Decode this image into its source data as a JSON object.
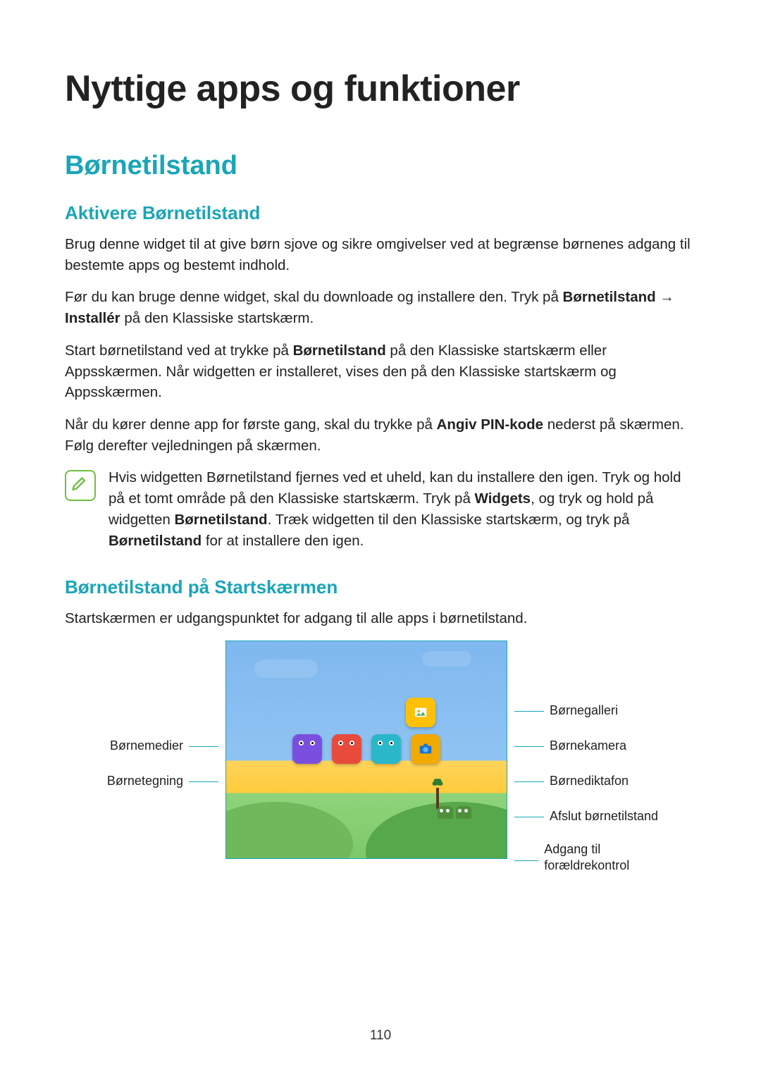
{
  "title": "Nyttige apps og funktioner",
  "section_h2": "Børnetilstand",
  "section_h3a": "Aktivere Børnetilstand",
  "p1": "Brug denne widget til at give børn sjove og sikre omgivelser ved at begrænse børnenes adgang til bestemte apps og bestemt indhold.",
  "p2a": "Før du kan bruge denne widget, skal du downloade og installere den. Tryk på ",
  "p2b_bold": "Børnetilstand",
  "p2c": " → ",
  "p2d_bold": "Installér",
  "p2e": " på den Klassiske startskærm.",
  "p3a": "Start børnetilstand ved at trykke på ",
  "p3b_bold": "Børnetilstand",
  "p3c": " på den Klassiske startskærm eller Appsskærmen. Når widgetten er installeret, vises den på den Klassiske startskærm og Appsskærmen.",
  "p4a": "Når du kører denne app for første gang, skal du trykke på ",
  "p4b_bold": "Angiv PIN-kode",
  "p4c": " nederst på skærmen. Følg derefter vejledningen på skærmen.",
  "note_a": "Hvis widgetten Børnetilstand fjernes ved et uheld, kan du installere den igen. Tryk og hold på et tomt område på den Klassiske startskærm. Tryk på ",
  "note_b_bold": "Widgets",
  "note_c": ", og tryk og hold på widgetten ",
  "note_d_bold": "Børnetilstand",
  "note_e": ". Træk widgetten til den Klassiske startskærm, og tryk på ",
  "note_f_bold": "Børnetilstand",
  "note_g": " for at installere den igen.",
  "section_h3b": "Børnetilstand på Startskærmen",
  "p5": "Startskærmen er udgangspunktet for adgang til alle apps i børnetilstand.",
  "labels": {
    "left1": "Børnemedier",
    "left2": "Børnetegning",
    "right1": "Børnegalleri",
    "right2": "Børnekamera",
    "right3": "Børnediktafon",
    "right4": "Afslut børnetilstand",
    "right5": "Adgang til forældrekontrol"
  },
  "page_number": "110"
}
